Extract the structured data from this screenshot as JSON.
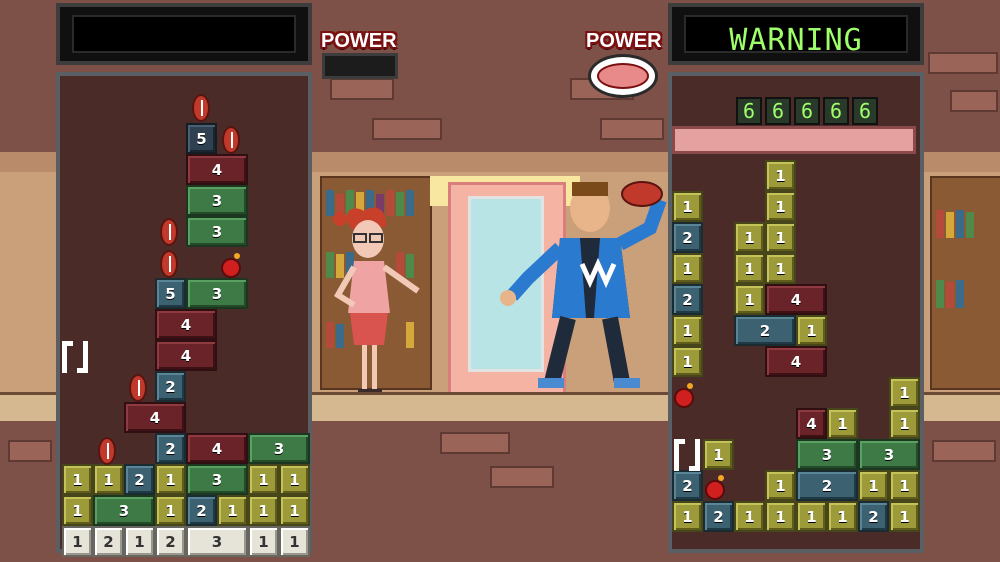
{
  "player1": {
    "status_text": "",
    "power_label": "POWER",
    "blocks": [
      {
        "col": 4,
        "row": 0,
        "w": 1,
        "v": "5",
        "c": "dark"
      },
      {
        "col": 4,
        "row": 1,
        "w": 2,
        "v": "4",
        "c": "maroon"
      },
      {
        "col": 4,
        "row": 2,
        "w": 2,
        "v": "3",
        "c": "green"
      },
      {
        "col": 4,
        "row": 3,
        "w": 2,
        "v": "3",
        "c": "green"
      },
      {
        "col": 3,
        "row": 5,
        "w": 1,
        "v": "5",
        "c": "teal"
      },
      {
        "col": 4,
        "row": 5,
        "w": 2,
        "v": "3",
        "c": "green"
      },
      {
        "col": 3,
        "row": 6,
        "w": 2,
        "v": "4",
        "c": "maroon"
      },
      {
        "col": 3,
        "row": 7,
        "w": 2,
        "v": "4",
        "c": "maroon"
      },
      {
        "col": 3,
        "row": 8,
        "w": 1,
        "v": "2",
        "c": "teal"
      },
      {
        "col": 2,
        "row": 9,
        "w": 2,
        "v": "4",
        "c": "maroon"
      },
      {
        "col": 3,
        "row": 10,
        "w": 1,
        "v": "2",
        "c": "teal"
      },
      {
        "col": 4,
        "row": 10,
        "w": 2,
        "v": "4",
        "c": "maroon"
      },
      {
        "col": 6,
        "row": 10,
        "w": 2,
        "v": "3",
        "c": "green"
      },
      {
        "col": 0,
        "row": 11,
        "w": 1,
        "v": "1",
        "c": "olive"
      },
      {
        "col": 1,
        "row": 11,
        "w": 1,
        "v": "1",
        "c": "olive"
      },
      {
        "col": 2,
        "row": 11,
        "w": 1,
        "v": "2",
        "c": "teal"
      },
      {
        "col": 3,
        "row": 11,
        "w": 1,
        "v": "1",
        "c": "olive"
      },
      {
        "col": 4,
        "row": 11,
        "w": 2,
        "v": "3",
        "c": "green"
      },
      {
        "col": 6,
        "row": 11,
        "w": 1,
        "v": "1",
        "c": "olive"
      },
      {
        "col": 7,
        "row": 11,
        "w": 1,
        "v": "1",
        "c": "olive"
      },
      {
        "col": 0,
        "row": 12,
        "w": 1,
        "v": "1",
        "c": "olive"
      },
      {
        "col": 1,
        "row": 12,
        "w": 2,
        "v": "3",
        "c": "green"
      },
      {
        "col": 3,
        "row": 12,
        "w": 1,
        "v": "1",
        "c": "olive"
      },
      {
        "col": 4,
        "row": 12,
        "w": 1,
        "v": "2",
        "c": "teal"
      },
      {
        "col": 5,
        "row": 12,
        "w": 1,
        "v": "1",
        "c": "olive"
      },
      {
        "col": 6,
        "row": 12,
        "w": 1,
        "v": "1",
        "c": "olive"
      },
      {
        "col": 7,
        "row": 12,
        "w": 1,
        "v": "1",
        "c": "olive"
      },
      {
        "col": 0,
        "row": 13,
        "w": 1,
        "v": "1",
        "c": "white"
      },
      {
        "col": 1,
        "row": 13,
        "w": 1,
        "v": "2",
        "c": "white"
      },
      {
        "col": 2,
        "row": 13,
        "w": 1,
        "v": "1",
        "c": "white"
      },
      {
        "col": 3,
        "row": 13,
        "w": 1,
        "v": "2",
        "c": "white"
      },
      {
        "col": 4,
        "row": 13,
        "w": 2,
        "v": "3",
        "c": "white"
      },
      {
        "col": 6,
        "row": 13,
        "w": 1,
        "v": "1",
        "c": "white"
      },
      {
        "col": 7,
        "row": 13,
        "w": 1,
        "v": "1",
        "c": "white"
      }
    ]
  },
  "player2": {
    "status_text": "WARNING",
    "power_label": "POWER",
    "counter_digits": [
      "6",
      "6",
      "6",
      "6",
      "6"
    ],
    "blocks": [
      {
        "col": 3,
        "row": 0,
        "w": 1,
        "v": "1",
        "c": "olive"
      },
      {
        "col": 0,
        "row": 1,
        "w": 1,
        "v": "1",
        "c": "olive"
      },
      {
        "col": 3,
        "row": 1,
        "w": 1,
        "v": "1",
        "c": "olive"
      },
      {
        "col": 0,
        "row": 2,
        "w": 1,
        "v": "2",
        "c": "teal"
      },
      {
        "col": 2,
        "row": 2,
        "w": 1,
        "v": "1",
        "c": "olive"
      },
      {
        "col": 3,
        "row": 2,
        "w": 1,
        "v": "1",
        "c": "olive"
      },
      {
        "col": 0,
        "row": 3,
        "w": 1,
        "v": "1",
        "c": "olive"
      },
      {
        "col": 2,
        "row": 3,
        "w": 1,
        "v": "1",
        "c": "olive"
      },
      {
        "col": 3,
        "row": 3,
        "w": 1,
        "v": "1",
        "c": "olive"
      },
      {
        "col": 0,
        "row": 4,
        "w": 1,
        "v": "2",
        "c": "teal"
      },
      {
        "col": 2,
        "row": 4,
        "w": 1,
        "v": "1",
        "c": "olive"
      },
      {
        "col": 3,
        "row": 4,
        "w": 2,
        "v": "4",
        "c": "maroon"
      },
      {
        "col": 0,
        "row": 5,
        "w": 1,
        "v": "1",
        "c": "olive"
      },
      {
        "col": 2,
        "row": 5,
        "w": 2,
        "v": "2",
        "c": "teal"
      },
      {
        "col": 4,
        "row": 5,
        "w": 1,
        "v": "1",
        "c": "olive"
      },
      {
        "col": 0,
        "row": 6,
        "w": 1,
        "v": "1",
        "c": "olive"
      },
      {
        "col": 3,
        "row": 6,
        "w": 2,
        "v": "4",
        "c": "maroon"
      },
      {
        "col": 7,
        "row": 7,
        "w": 1,
        "v": "1",
        "c": "olive"
      },
      {
        "col": 4,
        "row": 8,
        "w": 1,
        "v": "4",
        "c": "maroon"
      },
      {
        "col": 5,
        "row": 8,
        "w": 1,
        "v": "1",
        "c": "olive"
      },
      {
        "col": 7,
        "row": 8,
        "w": 1,
        "v": "1",
        "c": "olive"
      },
      {
        "col": 1,
        "row": 9,
        "w": 1,
        "v": "1",
        "c": "olive"
      },
      {
        "col": 4,
        "row": 9,
        "w": 2,
        "v": "3",
        "c": "green"
      },
      {
        "col": 6,
        "row": 9,
        "w": 2,
        "v": "3",
        "c": "green"
      },
      {
        "col": 0,
        "row": 10,
        "w": 1,
        "v": "2",
        "c": "teal"
      },
      {
        "col": 3,
        "row": 10,
        "w": 1,
        "v": "1",
        "c": "olive"
      },
      {
        "col": 4,
        "row": 10,
        "w": 2,
        "v": "2",
        "c": "teal"
      },
      {
        "col": 6,
        "row": 10,
        "w": 1,
        "v": "1",
        "c": "olive"
      },
      {
        "col": 7,
        "row": 10,
        "w": 1,
        "v": "1",
        "c": "olive"
      },
      {
        "col": 0,
        "row": 11,
        "w": 1,
        "v": "1",
        "c": "olive"
      },
      {
        "col": 1,
        "row": 11,
        "w": 1,
        "v": "2",
        "c": "teal"
      },
      {
        "col": 2,
        "row": 11,
        "w": 1,
        "v": "1",
        "c": "olive"
      },
      {
        "col": 3,
        "row": 11,
        "w": 1,
        "v": "1",
        "c": "olive"
      },
      {
        "col": 4,
        "row": 11,
        "w": 1,
        "v": "1",
        "c": "olive"
      },
      {
        "col": 5,
        "row": 11,
        "w": 1,
        "v": "1",
        "c": "olive"
      },
      {
        "col": 6,
        "row": 11,
        "w": 1,
        "v": "2",
        "c": "teal"
      },
      {
        "col": 7,
        "row": 11,
        "w": 1,
        "v": "1",
        "c": "olive"
      }
    ]
  },
  "colors": {
    "olive": "#9d9a3a",
    "green": "#3d7a45",
    "teal": "#3c6170",
    "maroon": "#6a2328",
    "white": "#e6e3d8",
    "warning_text": "#9fff6a",
    "power_outline": "#7a1010"
  },
  "icons": [
    "football-icon",
    "bomb-icon",
    "cursor-bracket-icon"
  ]
}
